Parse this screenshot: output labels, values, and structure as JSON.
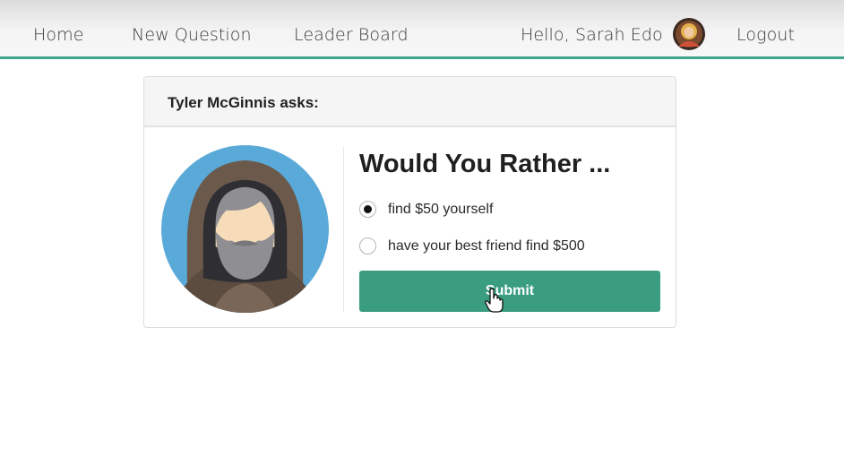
{
  "nav": {
    "home": "Home",
    "new_question": "New Question",
    "leader_board": "Leader Board",
    "greeting": "Hello, Sarah Edo",
    "logout": "Logout"
  },
  "card": {
    "header": "Tyler McGinnis asks:",
    "title": "Would You Rather ...",
    "options": [
      {
        "label": "find $50 yourself",
        "selected": true
      },
      {
        "label": "have your best friend find $500",
        "selected": false
      }
    ],
    "submit_label": "Submit"
  },
  "colors": {
    "accent": "#3a9d80",
    "nav_underline": "#41a58d",
    "avatar_background": "#5aaad9"
  },
  "icons": {
    "user_avatar": "user-avatar-icon",
    "author_avatar": "hooded-man-avatar-icon",
    "cursor": "hand-pointer-cursor-icon"
  }
}
